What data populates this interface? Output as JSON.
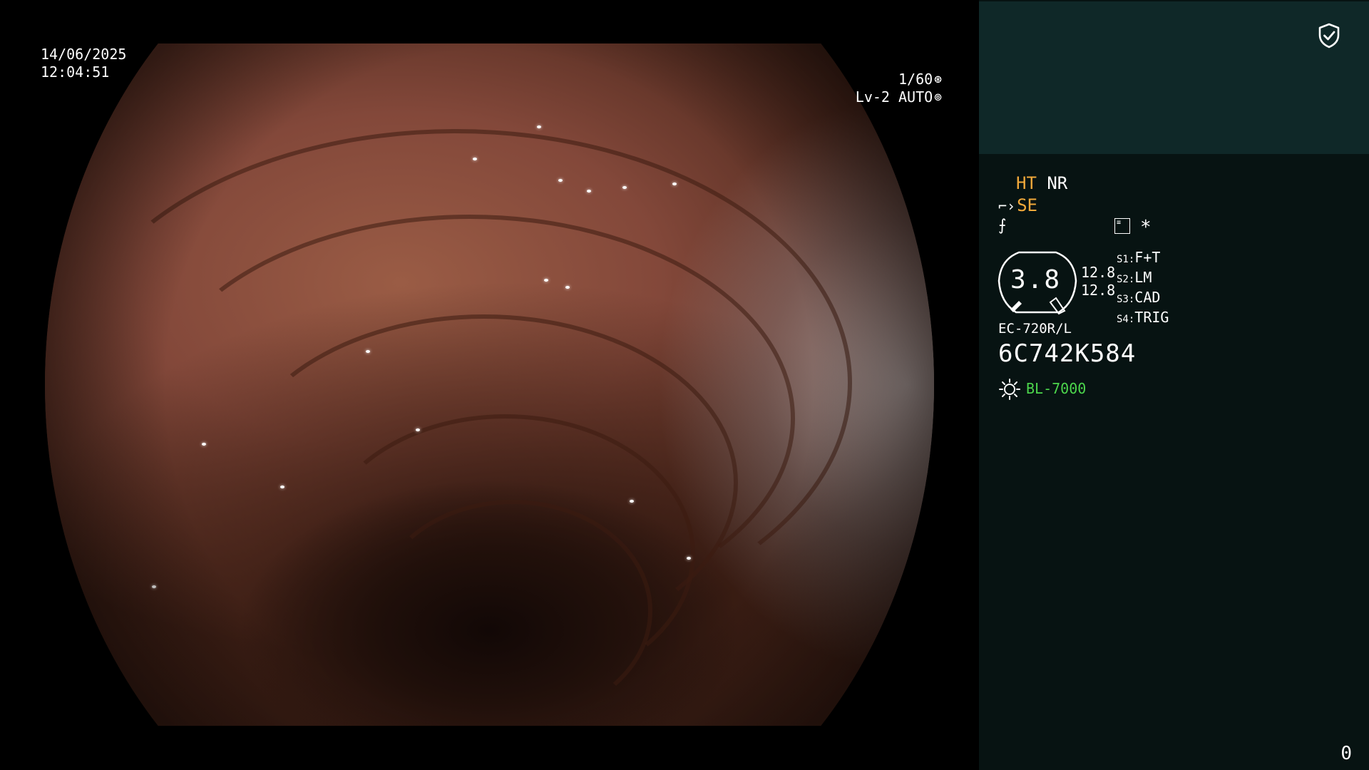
{
  "video": {
    "date": "14/06/2025",
    "time": "12:04:51",
    "shutter": "1/60",
    "shutter_icon": "shutter-icon",
    "iris_mode": "Lv-2 AUTO",
    "iris_icon": "iris-icon"
  },
  "panel": {
    "status_icon": "shield-check-icon",
    "ht": "HT",
    "nr": "NR",
    "se": "SE",
    "se_icon": "scope-angle-icon",
    "bolt_icon": "freeze-icon",
    "list_icon": "record-list-icon",
    "asterisk": "*",
    "gauge_value": "3.8",
    "side_values": [
      "12.8",
      "12.8"
    ],
    "switches": [
      {
        "key": "S1",
        "value": "F+T"
      },
      {
        "key": "S2",
        "value": "LM"
      },
      {
        "key": "S3",
        "value": "CAD"
      },
      {
        "key": "S4",
        "value": "TRIG"
      }
    ],
    "scope_model": "EC-720R/L",
    "scope_serial": "6C742K584",
    "lamp_icon": "light-source-icon",
    "light_source": "BL-7000",
    "counter": "0"
  },
  "colors": {
    "accent_orange": "#f2a93b",
    "lamp_green": "#4cd64c",
    "panel_bg": "#071312",
    "panel_header_bg": "#0f2828"
  }
}
